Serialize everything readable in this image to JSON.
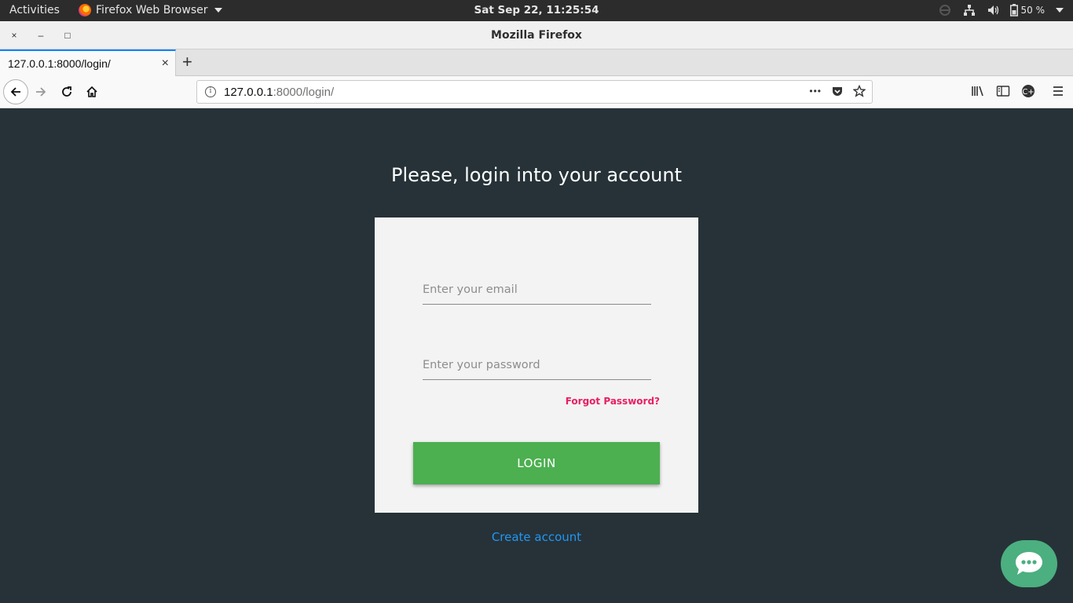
{
  "topbar": {
    "activities": "Activities",
    "app_name": "Firefox Web Browser",
    "clock": "Sat Sep 22, 11:25:54",
    "battery": "50 %"
  },
  "window": {
    "title": "Mozilla Firefox",
    "close": "×",
    "minimize": "–",
    "maximize": "□"
  },
  "tabs": [
    {
      "label": "127.0.0.1:8000/login/",
      "close": "×"
    }
  ],
  "newtab": "+",
  "navbar": {
    "url_host": "127.0.0.1",
    "url_rest": ":8000/login/",
    "more": "•••"
  },
  "page": {
    "heading": "Please, login into your account",
    "email_placeholder": "Enter your email",
    "password_placeholder": "Enter your password",
    "forgot": "Forgot Password?",
    "login": "LOGIN",
    "create_account": "Create account"
  },
  "colors": {
    "page_bg": "#263238",
    "card_bg": "#f3f3f3",
    "login_button": "#4caf50",
    "forgot_link": "#e91e63",
    "create_link": "#2196f3",
    "chat_button": "#4caf80"
  }
}
